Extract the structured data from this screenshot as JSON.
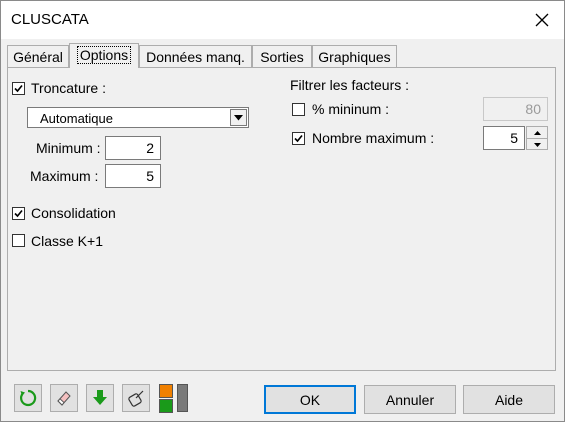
{
  "window": {
    "title": "CLUSCATA"
  },
  "tabs": [
    {
      "label": "Général"
    },
    {
      "label": "Options"
    },
    {
      "label": "Données manq."
    },
    {
      "label": "Sorties"
    },
    {
      "label": "Graphiques"
    }
  ],
  "options": {
    "troncature": {
      "label": "Troncature :",
      "checked": true
    },
    "mode_select": {
      "value": "Automatique"
    },
    "minimum": {
      "label": "Minimum :",
      "value": "2"
    },
    "maximum": {
      "label": "Maximum :",
      "value": "5"
    },
    "consolidation": {
      "label": "Consolidation",
      "checked": true
    },
    "classe_k1": {
      "label": "Classe K+1",
      "checked": false
    },
    "filter_title": "Filtrer les facteurs :",
    "pct_minimum": {
      "label": "% mininum :",
      "checked": false,
      "value": "80"
    },
    "nombre_max": {
      "label": "Nombre maximum :",
      "checked": true,
      "value": "5"
    }
  },
  "buttons": {
    "ok": "OK",
    "cancel": "Annuler",
    "help": "Aide"
  },
  "icons": [
    "reset-icon",
    "eraser-icon",
    "down-arrow-icon",
    "select-icon",
    "color-swatch-icon"
  ],
  "colors": {
    "green": "#1a9a1a",
    "orange": "#f08000"
  }
}
